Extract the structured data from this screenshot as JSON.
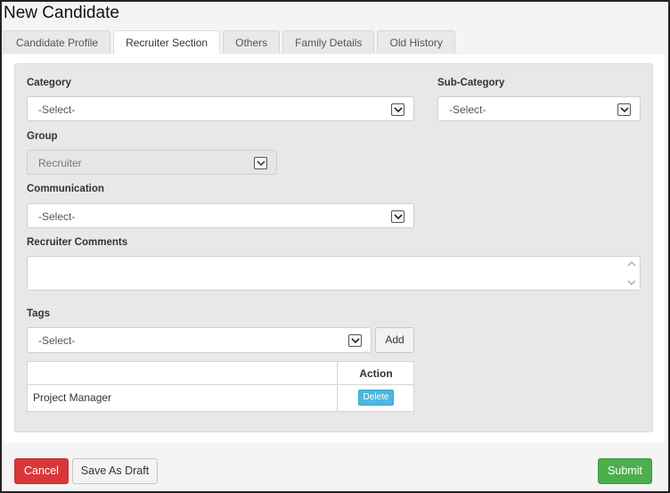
{
  "page": {
    "title": "New Candidate"
  },
  "tabs": [
    {
      "label": "Candidate Profile"
    },
    {
      "label": "Recruiter Section"
    },
    {
      "label": "Others"
    },
    {
      "label": "Family Details"
    },
    {
      "label": "Old History"
    }
  ],
  "active_tab": "Recruiter Section",
  "form": {
    "category": {
      "label": "Category",
      "value": "-Select-"
    },
    "sub_category": {
      "label": "Sub-Category",
      "value": "-Select-"
    },
    "group": {
      "label": "Group",
      "value": "Recruiter"
    },
    "communication": {
      "label": "Communication",
      "value": "-Select-"
    },
    "recruiter_comments": {
      "label": "Recruiter Comments",
      "value": ""
    },
    "tags": {
      "label": "Tags",
      "value": "-Select-",
      "add_label": "Add"
    }
  },
  "tags_table": {
    "headers": [
      "",
      "Action"
    ],
    "rows": [
      {
        "name": "Project Manager",
        "action_label": "Delete"
      }
    ]
  },
  "footer": {
    "cancel_label": "Cancel",
    "save_draft_label": "Save As Draft",
    "submit_label": "Submit"
  },
  "colors": {
    "cancel": "#d9383a",
    "submit": "#4cae4c",
    "delete": "#4db8e0"
  }
}
